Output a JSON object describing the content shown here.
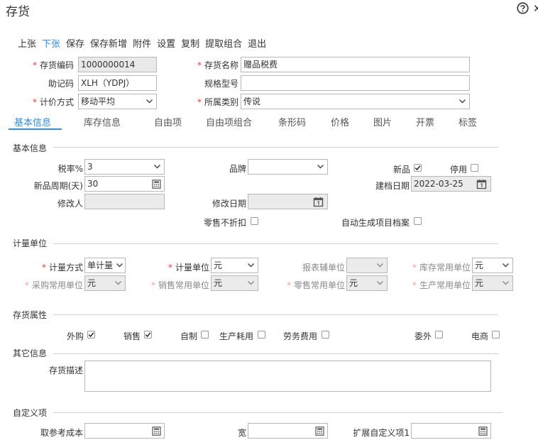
{
  "window": {
    "title": "存货",
    "close_glyph": "✕"
  },
  "toolbar": [
    "上张",
    "下张",
    "保存",
    "保存新增",
    "附件",
    "设置",
    "复制",
    "提取组合",
    "退出"
  ],
  "header": {
    "code_label": "存货编码",
    "code_value": "1000000014",
    "name_label": "存货名称",
    "name_value": "赠品税费",
    "mnemonic_label": "助记码",
    "mnemonic_value": "XLH（YDPJ）",
    "spec_label": "规格型号",
    "spec_value": "",
    "pricing_label": "计价方式",
    "pricing_value": "移动平均",
    "category_label": "所属类别",
    "category_value": "传说"
  },
  "tabs": [
    "基本信息",
    "库存信息",
    "自由项",
    "自由项组合",
    "条形码",
    "价格",
    "图片",
    "开票",
    "标签"
  ],
  "basic": {
    "section": "基本信息",
    "tax_label": "税率%",
    "tax_value": "3",
    "brand_label": "品牌",
    "brand_value": "",
    "new_label": "新品",
    "disabled_label": "停用",
    "cycle_label": "新品周期(天)",
    "cycle_value": "30",
    "created_label": "建档日期",
    "created_value": "2022-03-25",
    "modifier_label": "修改人",
    "modifier_value": "",
    "modified_label": "修改日期",
    "modified_value": "",
    "nodiscount_label": "零售不折扣",
    "autogen_label": "自动生成项目档案"
  },
  "units": {
    "section": "计量单位",
    "method_label": "计量方式",
    "method_value": "单计量",
    "unit_label": "计量单位",
    "unit_value": "元",
    "report_label": "报表辅单位",
    "report_value": "",
    "stock_label": "库存常用单位",
    "stock_value": "元",
    "purchase_label": "采购常用单位",
    "purchase_value": "元",
    "sale_label": "销售常用单位",
    "sale_value": "元",
    "retail_label": "零售常用单位",
    "retail_value": "元",
    "production_label": "生产常用单位",
    "production_value": "元"
  },
  "attrs": {
    "section": "存货属性",
    "purchase": "外购",
    "sale": "销售",
    "self_made": "自制",
    "production_use": "生产耗用",
    "service": "劳务费用",
    "outsource": "委外",
    "ecommerce": "电商"
  },
  "other": {
    "section": "其它信息",
    "desc_label": "存货描述",
    "desc_value": ""
  },
  "custom": {
    "section": "自定义项",
    "ref_cost_label": "取参考成本",
    "ref_cost_value": "",
    "width_label": "宽",
    "width_value": "",
    "ext1_label": "扩展自定义项1",
    "ext1_value": ""
  },
  "colors": {
    "accent": "#2d8cf0",
    "required": "#e4393c"
  }
}
